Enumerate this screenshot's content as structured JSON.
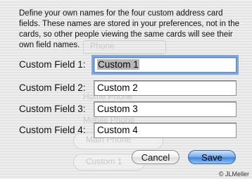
{
  "dialog": {
    "description": "Define your own names for the four custom address card fields. These names are stored in your preferences, not in the cards, so other people viewing the same cards will see their own field names.",
    "fields": [
      {
        "label": "Custom Field 1:",
        "value": "Custom 1",
        "focused": true
      },
      {
        "label": "Custom Field 2:",
        "value": "Custom 2",
        "focused": false
      },
      {
        "label": "Custom Field 3:",
        "value": "Custom 3",
        "focused": false
      },
      {
        "label": "Custom Field 4:",
        "value": "Custom 4",
        "focused": false
      }
    ],
    "cancel_label": "Cancel",
    "save_label": "Save"
  },
  "background": {
    "ghost_labels": [
      "Phone",
      "Home Phone",
      "Mobile Phone",
      "Main Phone",
      "Custom 1"
    ]
  },
  "watermark": "© JLMeller",
  "colors": {
    "save_button": "#5b9be8",
    "focus_ring": "#7da6dc",
    "selection": "#b7b7b7"
  }
}
